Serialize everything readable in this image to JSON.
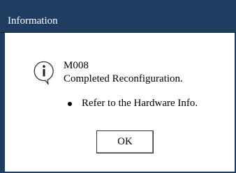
{
  "dialog": {
    "title": "Information",
    "code": "M008",
    "message": "Completed Reconfiguration.",
    "bullets": [
      "Refer to the Hardware Info."
    ],
    "ok_label": "OK",
    "icon": "info-icon"
  },
  "colors": {
    "titlebar": "#1f3d60",
    "background": "#ffffff",
    "text": "#000000"
  }
}
